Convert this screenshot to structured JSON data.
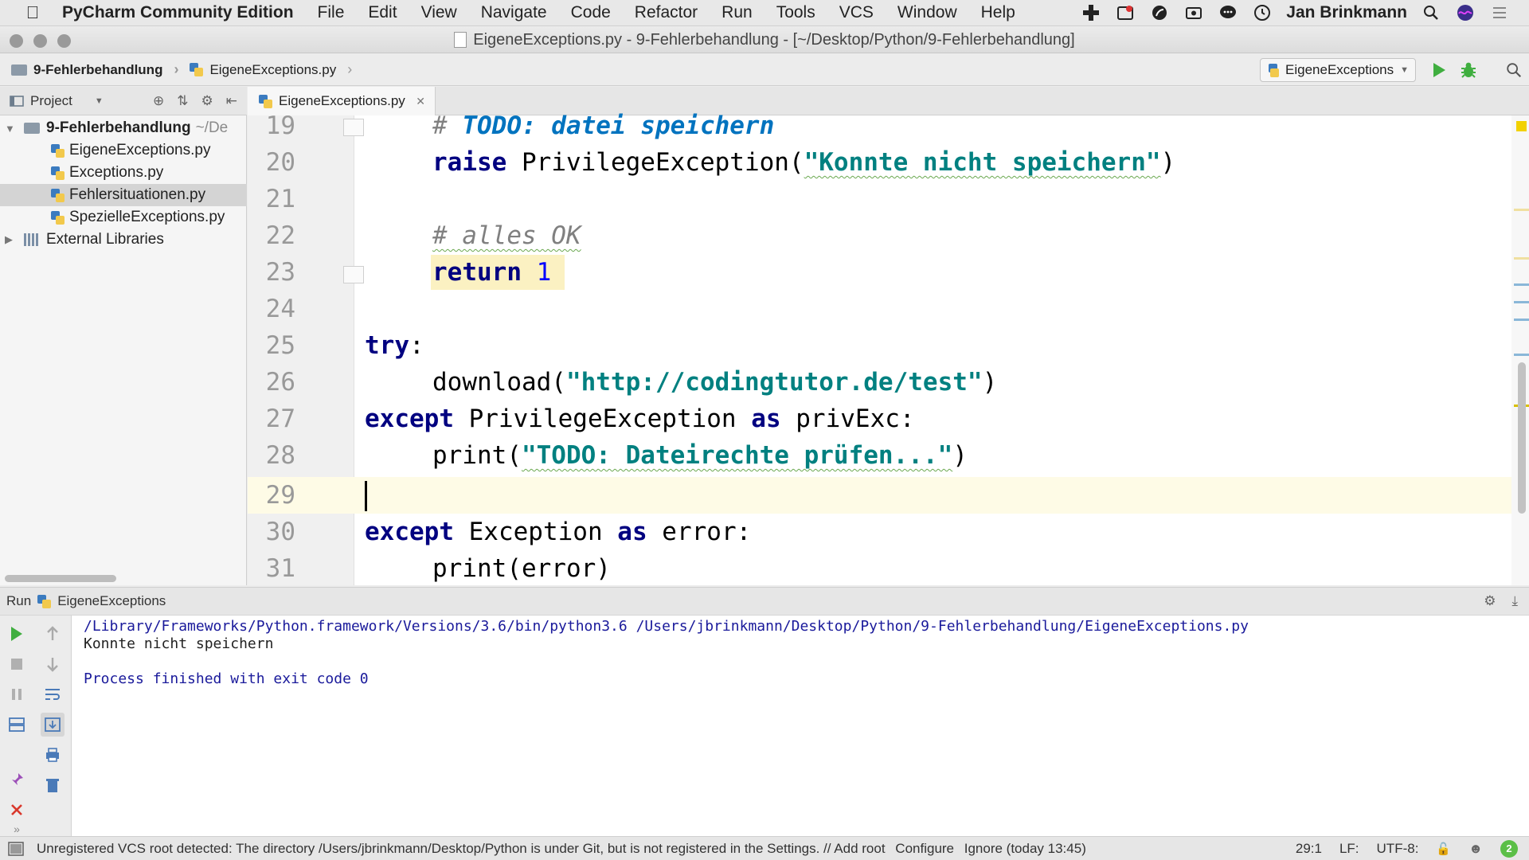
{
  "menubar": {
    "app_name": "PyCharm Community Edition",
    "items": [
      "File",
      "Edit",
      "View",
      "Navigate",
      "Code",
      "Refactor",
      "Run",
      "Tools",
      "VCS",
      "Window",
      "Help"
    ],
    "user": "Jan Brinkmann"
  },
  "window": {
    "title": "EigeneExceptions.py - 9-Fehlerbehandlung - [~/Desktop/Python/9-Fehlerbehandlung]"
  },
  "navbar": {
    "crumbs": [
      "9-Fehlerbehandlung",
      "EigeneExceptions.py"
    ],
    "run_config": "EigeneExceptions"
  },
  "project": {
    "header_label": "Project",
    "root": "9-Fehlerbehandlung",
    "root_path": "~/De",
    "files": [
      "EigeneExceptions.py",
      "Exceptions.py",
      "Fehlersituationen.py",
      "SpezielleExceptions.py"
    ],
    "external": "External Libraries"
  },
  "editor": {
    "tab": "EigeneExceptions.py",
    "line_numbers": [
      "19",
      "20",
      "21",
      "22",
      "23",
      "24",
      "25",
      "26",
      "27",
      "28",
      "29",
      "30",
      "31"
    ],
    "code": {
      "l19_comment": "# ",
      "l19_todo": "TODO: datei speichern",
      "l20_kw": "raise",
      "l20_call": " PrivilegeException(",
      "l20_str": "\"Konnte nicht speichern\"",
      "l20_end": ")",
      "l22_comment": "# alles OK",
      "l23_kw": "return",
      "l23_num": "1",
      "l25_kw": "try",
      "l25_end": ":",
      "l26_call": "download(",
      "l26_str": "\"http://codingtutor.de/test\"",
      "l26_end": ")",
      "l27_kw": "except",
      "l27_mid": " PrivilegeException ",
      "l27_as": "as",
      "l27_end": " privExc:",
      "l28_call": "print(",
      "l28_str": "\"TODO: Dateirechte prüfen...\"",
      "l28_end": ")",
      "l30_kw": "except",
      "l30_mid": " Exception ",
      "l30_as": "as",
      "l30_end": " error:",
      "l31_call": "print(error)"
    }
  },
  "run": {
    "label": "Run",
    "config": "EigeneExceptions",
    "output": [
      "/Library/Frameworks/Python.framework/Versions/3.6/bin/python3.6 /Users/jbrinkmann/Desktop/Python/9-Fehlerbehandlung/EigeneExceptions.py",
      "Konnte nicht speichern",
      "",
      "Process finished with exit code 0"
    ]
  },
  "statusbar": {
    "message": "Unregistered VCS root detected: The directory /Users/jbrinkmann/Desktop/Python is under Git, but is not registered in the Settings. // Add root",
    "configure": "Configure",
    "ignore": "Ignore (today 13:45)",
    "position": "29:1",
    "line_sep": "LF:",
    "encoding": "UTF-8:",
    "badge_count": "2"
  },
  "colors": {
    "keyword": "#000080",
    "string": "#008080",
    "todo": "#0073bf",
    "run_green": "#3fae3f",
    "stop_red": "#d9382c"
  }
}
